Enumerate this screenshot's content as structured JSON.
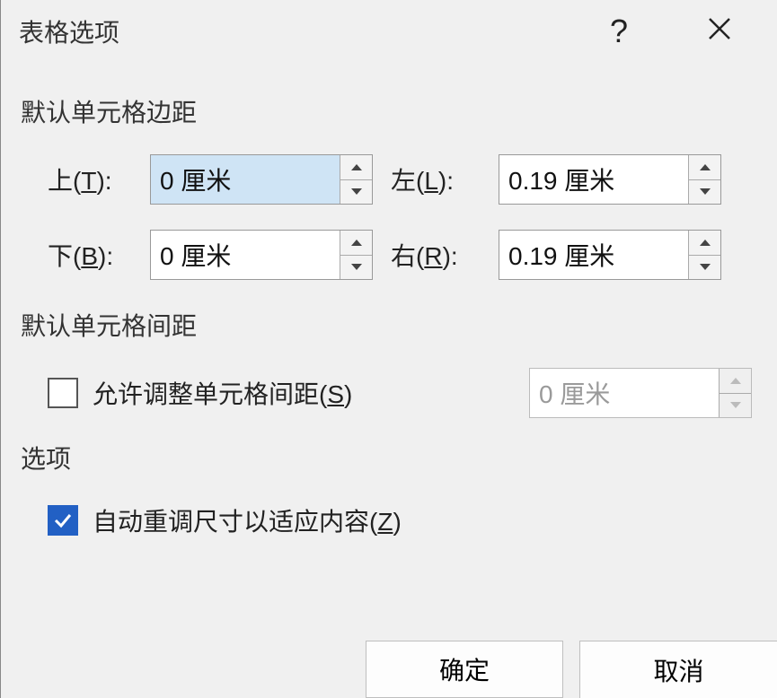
{
  "titlebar": {
    "title": "表格选项",
    "help": "?",
    "close": "✕"
  },
  "sections": {
    "default_margins": "默认单元格边距",
    "default_spacing": "默认单元格间距",
    "options": "选项"
  },
  "margins": {
    "top": {
      "label_prefix": "上(",
      "accel": "T",
      "label_suffix": "):",
      "value": "0 厘米"
    },
    "left": {
      "label_prefix": "左(",
      "accel": "L",
      "label_suffix": "):",
      "value": "0.19 厘米"
    },
    "bottom": {
      "label_prefix": "下(",
      "accel": "B",
      "label_suffix": "):",
      "value": "0 厘米"
    },
    "right": {
      "label_prefix": "右(",
      "accel": "R",
      "label_suffix": "):",
      "value": "0.19 厘米"
    }
  },
  "spacing": {
    "checkbox_label_prefix": "允许调整单元格间距(",
    "checkbox_accel": "S",
    "checkbox_label_suffix": ")",
    "value": "0 厘米",
    "checked": false
  },
  "auto_resize": {
    "label_prefix": "自动重调尺寸以适应内容(",
    "accel": "Z",
    "label_suffix": ")",
    "checked": true
  },
  "buttons": {
    "ok": "确定",
    "cancel": "取消"
  }
}
